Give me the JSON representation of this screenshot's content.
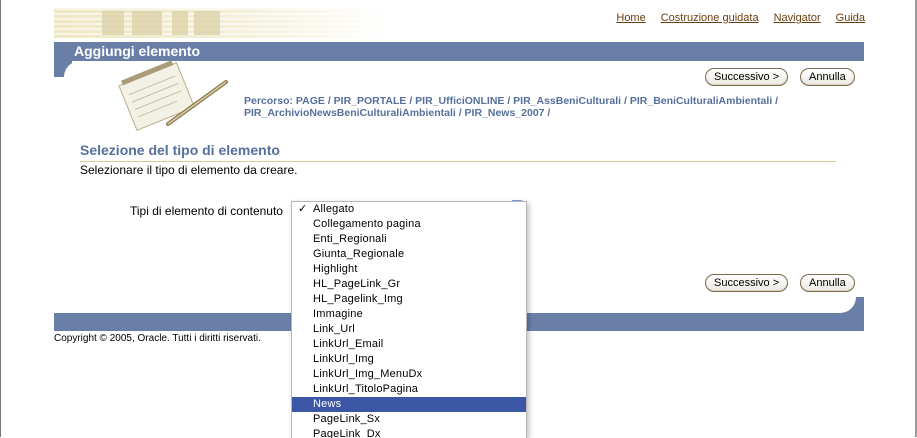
{
  "nav": {
    "links": [
      "Home",
      "Costruzione guidata",
      "Navigator",
      "Guida"
    ]
  },
  "header": {
    "title": "Aggiungi elemento"
  },
  "buttons": {
    "next": "Successivo >",
    "cancel": "Annulla"
  },
  "breadcrumb": {
    "text": "Percorso: PAGE / PIR_PORTALE / PIR_UfficiONLINE / PIR_AssBeniCulturali / PIR_BeniCulturaliAmbientali / PIR_ArchivioNewsBeniCulturaliAmbientali / PIR_News_2007 /"
  },
  "section": {
    "heading": "Selezione del tipo di elemento",
    "instruction": "Selezionare il tipo di elemento da creare."
  },
  "form": {
    "label": "Tipi di elemento di contenuto",
    "checked_item": "Allegato",
    "highlighted_item": "News",
    "options": [
      "Allegato",
      "Collegamento pagina",
      "Enti_Regionali",
      "Giunta_Regionale",
      "Highlight",
      "HL_PageLink_Gr",
      "HL_Pagelink_Img",
      "Immagine",
      "Link_Url",
      "LinkUrl_Email",
      "LinkUrl_Img",
      "LinkUrl_Img_MenuDx",
      "LinkUrl_TitoloPagina",
      "News",
      "PageLink_Sx",
      "PageLink_Dx"
    ]
  },
  "footer": {
    "copyright": "Copyright © 2005, Oracle. Tutti i diritti riservati."
  },
  "colors": {
    "bar": "#6a7fa8",
    "heading": "#56709b",
    "link": "#6b3e12",
    "selection": "#3c56a6"
  }
}
